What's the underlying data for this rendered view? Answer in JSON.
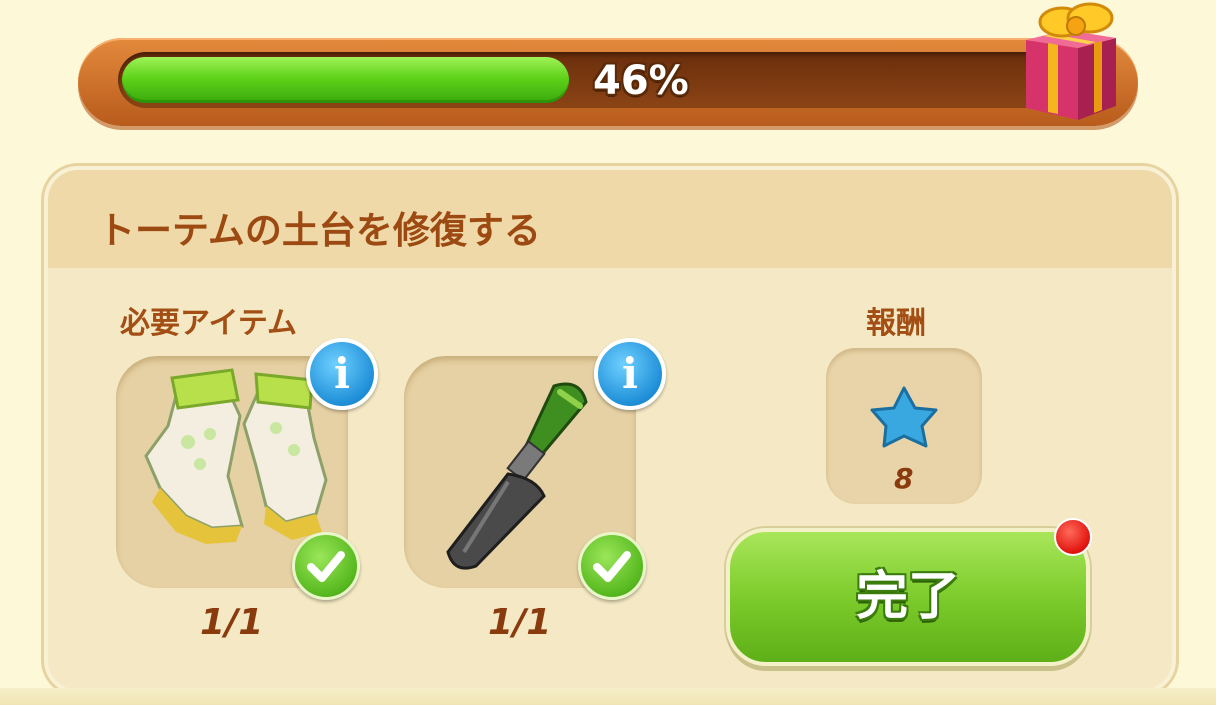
{
  "progress": {
    "value_percent": 46,
    "label": "46%",
    "fill_color": "#5fd31a"
  },
  "gift_icon": "gift-box-icon",
  "task": {
    "title": "トーテムの土台を修復する"
  },
  "required_items": {
    "label": "必要アイテム",
    "items": [
      {
        "name": "gardening-gloves",
        "icon": "gloves-icon",
        "count": "1/1",
        "completed": true
      },
      {
        "name": "garden-trowel",
        "icon": "trowel-icon",
        "count": "1/1",
        "completed": true
      }
    ]
  },
  "reward": {
    "label": "報酬",
    "icon": "blue-star-icon",
    "value": "8"
  },
  "actions": {
    "complete_label": "完了"
  },
  "colors": {
    "accent_text": "#a24e14",
    "button_green": "#7dcc2c",
    "info_blue": "#1f8fd8",
    "notification_red": "#e1130e"
  }
}
